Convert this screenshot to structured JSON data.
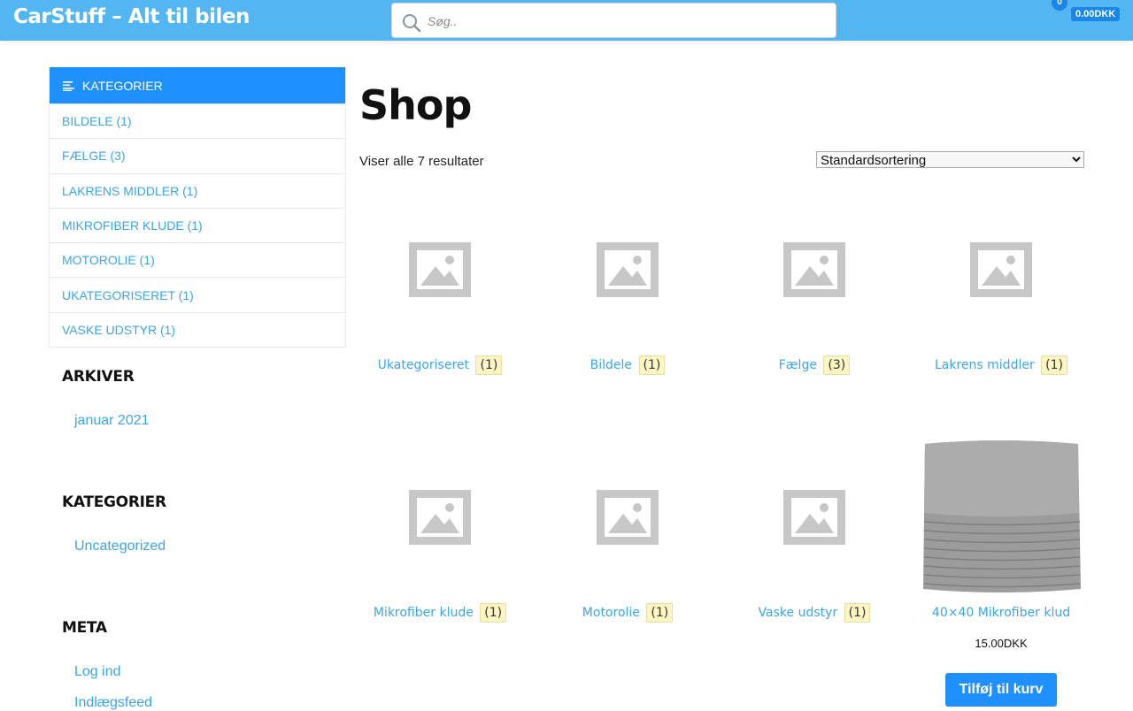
{
  "header": {
    "site_title": "CarStuff – Alt til bilen",
    "search_placeholder": "Søg..",
    "cart_count": "0",
    "cart_total": "0.00DKK"
  },
  "category_panel": {
    "title": "KATEGORIER",
    "items": [
      {
        "label": "BILDELE (1)"
      },
      {
        "label": "FÆLGE (3)"
      },
      {
        "label": "LAKRENS MIDDLER (1)"
      },
      {
        "label": "MIKROFIBER KLUDE (1)"
      },
      {
        "label": "MOTOROLIE (1)"
      },
      {
        "label": "UKATEGORISERET (1)"
      },
      {
        "label": "VASKE UDSTYR (1)"
      }
    ]
  },
  "archives": {
    "title": "ARKIVER",
    "items": [
      "januar 2021"
    ]
  },
  "categories_widget": {
    "title": "KATEGORIER",
    "items": [
      "Uncategorized"
    ]
  },
  "meta": {
    "title": "META",
    "items": [
      "Log ind",
      "Indlægsfeed"
    ]
  },
  "main": {
    "page_title": "Shop",
    "result_count": "Viser alle 7 resultater",
    "sort_selected": "Standardsortering"
  },
  "products": [
    {
      "name": "Ukategoriseret",
      "count": "(1)"
    },
    {
      "name": "Bildele",
      "count": "(1)"
    },
    {
      "name": "Fælge",
      "count": "(3)"
    },
    {
      "name": "Lakrens middler",
      "count": "(1)"
    },
    {
      "name": "Mikrofiber klude",
      "count": "(1)"
    },
    {
      "name": "Motorolie",
      "count": "(1)"
    },
    {
      "name": "Vaske udstyr",
      "count": "(1)"
    },
    {
      "name": "40×40 Mikrofiber klud",
      "price": "15.00",
      "currency": "DKK",
      "button": "Tilføj til kurv"
    }
  ],
  "colors": {
    "header_bg": "#53b6f0",
    "accent": "#1e90ff",
    "link": "#3ba5e8",
    "badge_bg": "#fdf6c4"
  }
}
